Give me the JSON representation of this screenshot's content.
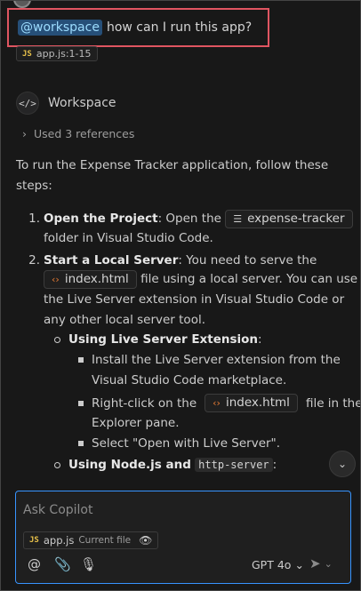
{
  "user_message": {
    "mention": "@workspace",
    "text": "how can I run this app?",
    "attachment": {
      "icon": "JS",
      "label": "app.js:1-15"
    }
  },
  "response": {
    "agent_icon": "</>",
    "agent_name": "Workspace",
    "references_label": "Used 3 references",
    "intro_line1": "To run the Expense Tracker application, follow these",
    "intro_line2": "steps:",
    "step1": {
      "num": "1.",
      "title": "Open the Project",
      "pre": ": Open the",
      "chip": "expense-tracker",
      "post": "folder in Visual Studio Code."
    },
    "step2": {
      "num": "2.",
      "title": "Start a Local Server",
      "text1": ": You need to serve the",
      "chip": "index.html",
      "text2": "file using a local server. You can use",
      "text3": "the Live Server extension in Visual Studio Code or",
      "text4": "any other local server tool."
    },
    "sub1_title": "Using Live Server Extension",
    "sub1_colon": ":",
    "sub1_item1_line1": "Install the Live Server extension from the",
    "sub1_item1_line2": "Visual Studio Code marketplace.",
    "sub1_item2_pre": "Right-click on the",
    "sub1_item2_chip": "index.html",
    "sub1_item2_post": "file in the",
    "sub1_item2_line2": "Explorer pane.",
    "sub1_item3": "Select \"Open with Live Server\".",
    "sub2_title": "Using Node.js and",
    "sub2_code": "http-server",
    "sub2_colon": ":"
  },
  "input": {
    "placeholder": "Ask Copilot",
    "context_chip_icon": "JS",
    "context_chip_file": "app.js",
    "context_chip_sub": "Current file",
    "model": "GPT 4o"
  },
  "icons": {
    "mention": "at-icon",
    "attach": "paperclip-icon",
    "mic": "microphone-icon",
    "send": "send-icon",
    "eye": "eye-icon"
  }
}
